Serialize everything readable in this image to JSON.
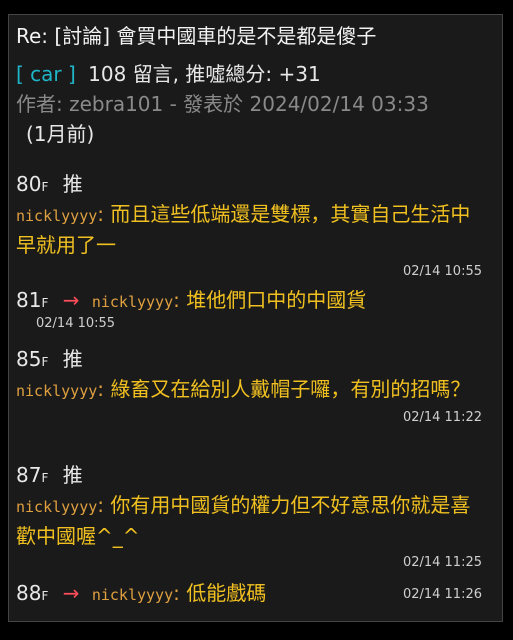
{
  "post": {
    "title": "Re: [討論] 會買中國車的是不是都是傻子",
    "board": "[ car ]",
    "stats": "108 留言, 推噓總分: +31",
    "author_line": "作者: zebra101 - 發表於 2024/02/14 03:33",
    "ago": "(1月前)"
  },
  "pushes": [
    {
      "floor": "80",
      "floor_suffix": "F",
      "tag": "推",
      "user": "nicklyyyy",
      "text": "而且這些低端還是雙標，其實自己生活中早就用了一",
      "time": "02/14 10:55"
    },
    {
      "floor": "81",
      "floor_suffix": "F",
      "tag": "→",
      "user": "nicklyyyy",
      "text": "堆他們口中的中國貨",
      "time": "02/14 10:55"
    },
    {
      "floor": "85",
      "floor_suffix": "F",
      "tag": "推",
      "user": "nicklyyyy",
      "text": "綠畜又在給別人戴帽子囉，有別的招嗎？",
      "time": "02/14 11:22"
    },
    {
      "floor": "87",
      "floor_suffix": "F",
      "tag": "推",
      "user": "nicklyyyy",
      "text": "你有用中國貨的權力但不好意思你就是喜歡中國喔^_^",
      "time": "02/14 11:25"
    },
    {
      "floor": "88",
      "floor_suffix": "F",
      "tag": "→",
      "user": "nicklyyyy",
      "text": "低能戲碼",
      "time": "02/14 11:26"
    }
  ],
  "colors": {
    "board": "#1fb5c8",
    "push_text": "#f0c020",
    "username": "#e0a040",
    "arrow": "#ff4d5a",
    "background": "#1a1a1a"
  }
}
